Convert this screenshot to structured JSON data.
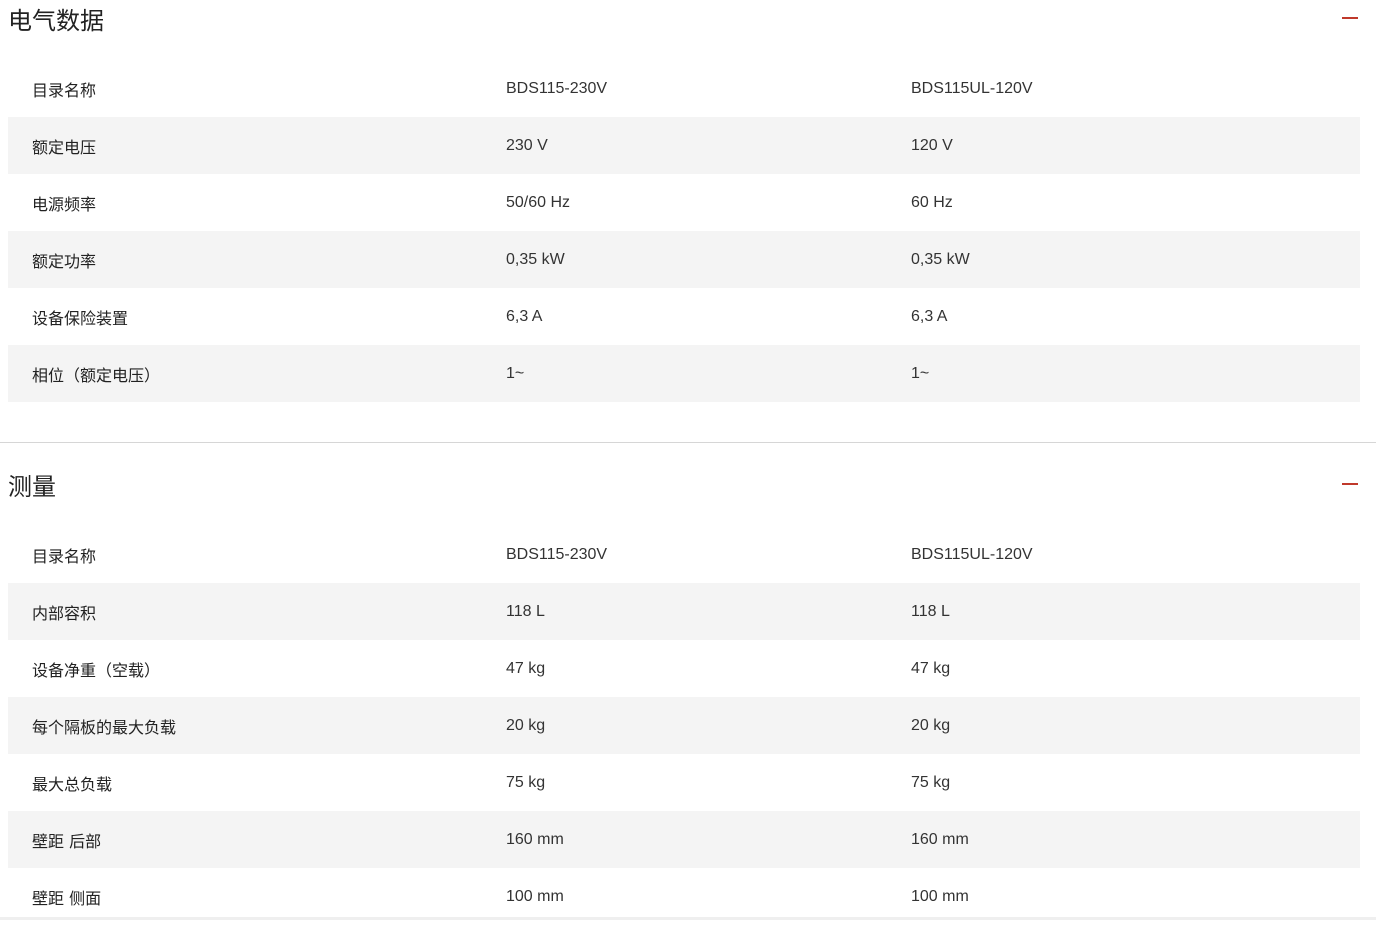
{
  "sections": [
    {
      "title": "电气数据",
      "collapse_icon": "minus-icon",
      "rows": [
        {
          "label": "目录名称",
          "a": "BDS115-230V",
          "b": "BDS115UL-120V"
        },
        {
          "label": "额定电压",
          "a": "230 V",
          "b": "120 V"
        },
        {
          "label": "电源频率",
          "a": "50/60 Hz",
          "b": "60 Hz"
        },
        {
          "label": "额定功率",
          "a": "0,35 kW",
          "b": "0,35 kW"
        },
        {
          "label": "设备保险装置",
          "a": "6,3 A",
          "b": "6,3 A"
        },
        {
          "label": "相位（额定电压）",
          "a": "1~",
          "b": "1~"
        }
      ]
    },
    {
      "title": "测量",
      "collapse_icon": "minus-icon",
      "rows": [
        {
          "label": "目录名称",
          "a": "BDS115-230V",
          "b": "BDS115UL-120V"
        },
        {
          "label": "内部容积",
          "a": "118 L",
          "b": "118 L"
        },
        {
          "label": "设备净重（空载）",
          "a": "47 kg",
          "b": "47 kg"
        },
        {
          "label": "每个隔板的最大负载",
          "a": "20 kg",
          "b": "20 kg"
        },
        {
          "label": "最大总负载",
          "a": "75 kg",
          "b": "75 kg"
        },
        {
          "label": "壁距 后部",
          "a": "160 mm",
          "b": "160 mm"
        },
        {
          "label": "壁距 侧面",
          "a": "100 mm",
          "b": "100 mm"
        }
      ]
    }
  ],
  "colors": {
    "accent": "#c0392b",
    "row_alt": "#f4f4f4",
    "divider": "#d6d6d6"
  }
}
